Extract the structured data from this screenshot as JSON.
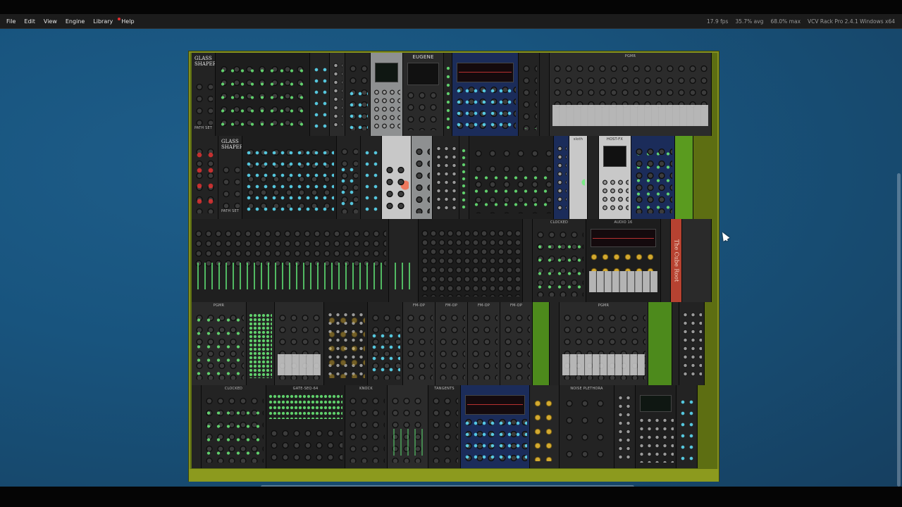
{
  "menu": {
    "items": [
      {
        "label": "File"
      },
      {
        "label": "Edit"
      },
      {
        "label": "View"
      },
      {
        "label": "Engine"
      },
      {
        "label": "Library"
      },
      {
        "label": "Help",
        "notification_dot_color": "#e03030"
      }
    ]
  },
  "status": {
    "fps": "17.9 fps",
    "avg": "35.7% avg",
    "max": "68.0% max",
    "app": "VCV Rack Pro 2.4.1 Windows x64"
  },
  "colors": {
    "workspace": "#18547e",
    "rack_rail": "#8c9a1e",
    "led_green": "#6cf07a",
    "led_cyan": "#5ee4ff",
    "led_amber": "#f2c133"
  },
  "modules": {
    "row1": {
      "glass_shaper_title": "GLASS SHAPER",
      "glass_shaper_footer": "PATH SET",
      "eugene": "EUGENE",
      "pgmr": "PGMR"
    },
    "row2": {
      "glass_shaper_title": "GLASS SHAPER",
      "glass_shaper_footer": "PATH SET",
      "sloth": "sloth",
      "host_fx": "HOST-FX"
    },
    "row3": {
      "clocked": "CLOCKED",
      "audio": "AUDIO 16",
      "cube": "The Cube Root"
    },
    "row4": {
      "pgmr": "PGMR",
      "fmop": "FM-OP"
    },
    "row5": {
      "clocked": "CLOCKED",
      "gate_seq": "GATE-SEQ-64",
      "knock": "KNOCK",
      "tangents": "TANGENTS",
      "noise_plethora": "NOISE PLETHORA"
    }
  }
}
